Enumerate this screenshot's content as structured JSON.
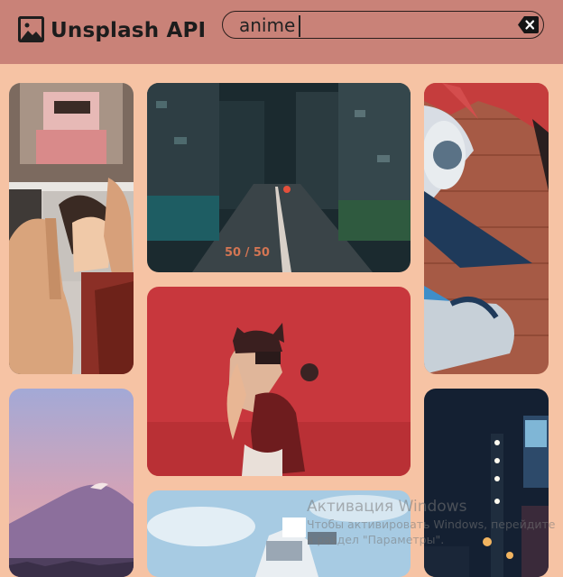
{
  "app": {
    "title": "Unsplash API"
  },
  "search": {
    "value": "anime"
  },
  "icons": {
    "logo": "image-icon",
    "clear": "close-icon"
  },
  "colors": {
    "header": "#c98278",
    "background": "#f6c3a4"
  },
  "photos": [
    "anime-figure-photos-hand",
    "night-city-street",
    "anime-face-mural-brick",
    "mount-fuji-sunset",
    "anime-figure-red-background",
    "night-city-signs",
    "gundam-statue-sky"
  ],
  "watermark": {
    "title": "Активация Windows",
    "line1": "Чтобы активировать Windows, перейдите",
    "line2": "в раздел \"Параметры\"."
  }
}
